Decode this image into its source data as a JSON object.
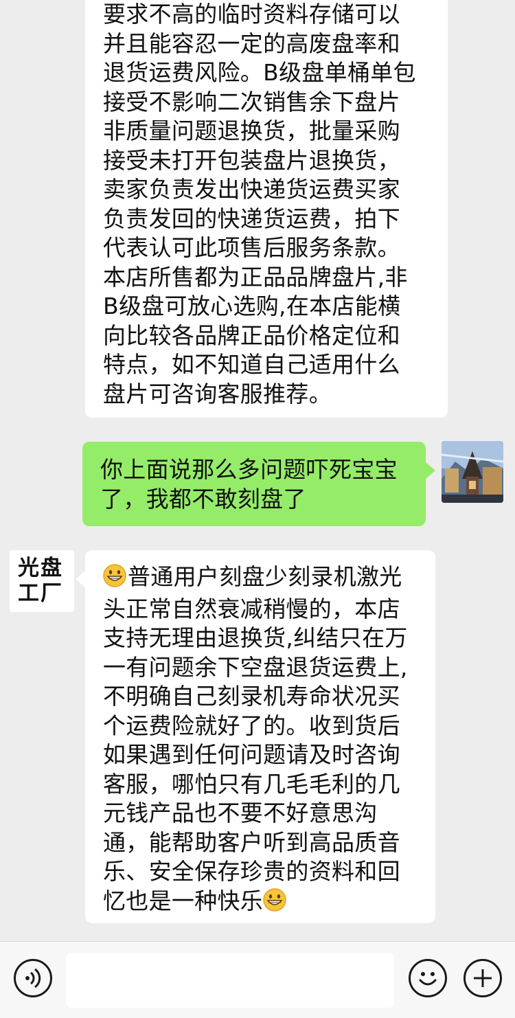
{
  "messages": {
    "top": {
      "text": "要求不高的临时资料存储可以\n并且能容忍一定的高废盘率和\n退货运费风险。B级盘单桶单包\n接受不影响二次销售余下盘片\n非质量问题退换货，批量采购\n接受未打开包装盘片退换货，\n卖家负责发出快递货运费买家\n负责发回的快递货运费，拍下\n代表认可此项售后服务条款。\n本店所售都为正品品牌盘片,非\nB级盘可放心选购,在本店能横\n向比较各品牌正品价格定位和\n特点，如不知道自己适用什么\n盘片可咨询客服推荐。"
    },
    "me": {
      "text": "你上面说那么多问题吓死宝宝\n了，我都不敢刻盘了"
    },
    "shop": {
      "avatar_text": "光盘\n工厂",
      "leading_emoji": "grinning-face-icon",
      "text": "普通用户刻盘少刻录机激光\n头正常自然衰减稍慢的，本店\n支持无理由退换货,纠结只在万\n一有问题余下空盘退货运费上,\n不明确自己刻录机寿命状况买\n个运费险就好了的。收到货后\n如果遇到任何问题请及时咨询\n客服，哪怕只有几毛毛利的几\n元钱产品也不要不好意思沟\n通，能帮助客户听到高品质音\n乐、安全保存珍贵的资料和回\n忆也是一种快乐",
      "trailing_emoji": "grinning-face-icon"
    }
  },
  "input_bar": {
    "value": "",
    "voice_icon": "voice-icon",
    "emoji_icon": "emoji-icon",
    "plus_icon": "plus-icon"
  },
  "colors": {
    "background": "#ededed",
    "my_bubble": "#95ec69",
    "other_bubble": "#ffffff",
    "input_bar": "#f7f7f7"
  }
}
